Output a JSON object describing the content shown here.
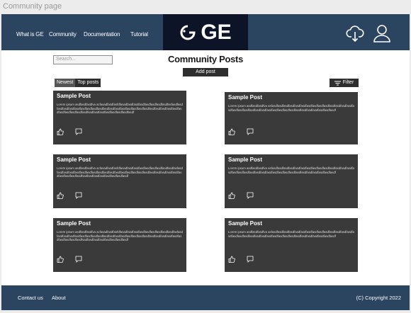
{
  "window": {
    "title": "Community page"
  },
  "navbar": {
    "links": [
      "What is GE",
      "Community",
      "Documentation",
      "Tutorial"
    ],
    "logo_text": "GE",
    "icons": [
      "cloud-download-icon",
      "user-icon"
    ]
  },
  "toolbar": {
    "search_placeholder": "Search...",
    "heading": "Community Posts",
    "add_post_label": "Add post",
    "sort_tabs": [
      "Newest",
      "Top posts"
    ],
    "filter_label": "Filter"
  },
  "posts": [
    {
      "title": "Sample Post",
      "body": "Lorem ipsum asdfasdfasdfva acfasadfasdfasfdfasadfasdfasdfasdfasdfasdfasdfasdfasfasdfasdfasdfasdfasdfasdfasdfasdfasdfasdfasdfasdfasdfasdfasdfasdfasdfasdfasdfasdfasdfasdfasdfasdfasdfasdfasdfasdfasdfsadfasdfasdfasdfasdfasdfasdfasdf"
    },
    {
      "title": "Sample Post",
      "body": "Lorem ipsum asdfasdfasdfva asfasdfasdfasdfasdfasdfasdfasdfasdfasdfasdfasdfasdfasdfasdfasdfasdfasdfasdfasdfasdfasdfasdfasdfasdfasdfasdfasdfasdfasdfasdfasdfasdfasdf"
    },
    {
      "title": "Sample Post",
      "body": "Lorem ipsum asdfasdfasdfva acfasadfasdfasfdfasadfasdfasdfasdfasdfasdfasdfasdfasdfasfasdfasdfasdfasdfasdfasdfasdfasdfasdfasdfasdfasdfasdfasdfasdfasdfasdfasdfasdfasdfasdfasdfasdfasdfasdfasdfasdfsadfasdfasdfasdfasdfasdfasdfasdf"
    },
    {
      "title": "Sample Post",
      "body": "Lorem ipsum asdfasdfasdfva asfasdfasdfasdfasdfasdfasdfasdfasdfasdfasdfasdfasdfasdfasdfasdfasdfasdfasdfasdfasdfasdfasdfasdfasdfasdfasdfasdfasdfasdfasdfasdfasdfasdf"
    },
    {
      "title": "Sample Post",
      "body": "Lorem ipsum asdfasdfasdfva acfasadfasdfasfdfasadfasdfasdfasdfasdfasdfasdfasdfasdfasfasdfasdfasdfasdfasdfasdfasdfasdfasdfasdfasdfasdfasdfasdfasdfasdfasdfasdfasdfasdfasdfasdfasdfasdfasdfasdfasdfsadfasdfasdfasdfasdfasdfasdfasdf"
    },
    {
      "title": "Sample Post",
      "body": "Lorem ipsum asdfasdfasdfva asfasdfasdfasdfasdfasdfasdfasdfasdfasdfasdfasdfasdfasdfasdfasdfasdfasdfasdfasdfasdfasdfasdfasdfasdfasdfasdfasdfasdfasdfasdfasdfasdfasdf"
    }
  ],
  "post_actions": [
    "thumbs-up-icon",
    "comment-icon"
  ],
  "footer": {
    "links": [
      "Contact us",
      "About"
    ],
    "copyright": "(C) Copyright 2022"
  }
}
